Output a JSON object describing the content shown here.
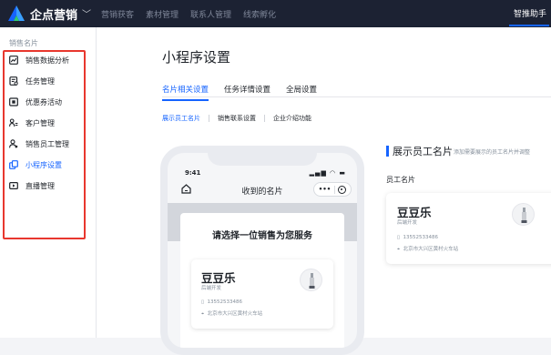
{
  "topbar": {
    "brand": "企点营销",
    "nav": [
      "营销获客",
      "素材管理",
      "联系人管理",
      "线索孵化"
    ],
    "helper": "智推助手"
  },
  "sidebar": {
    "title": "销售名片",
    "items": [
      {
        "label": "销售数据分析",
        "icon": "chart-icon"
      },
      {
        "label": "任务管理",
        "icon": "task-icon"
      },
      {
        "label": "优惠券活动",
        "icon": "coupon-icon"
      },
      {
        "label": "客户管理",
        "icon": "customer-icon"
      },
      {
        "label": "销售员工管理",
        "icon": "staff-icon"
      },
      {
        "label": "小程序设置",
        "icon": "miniprogram-icon",
        "active": true
      },
      {
        "label": "直播管理",
        "icon": "live-icon"
      }
    ]
  },
  "main": {
    "title": "小程序设置",
    "tabs": [
      {
        "label": "名片相关设置",
        "active": true
      },
      {
        "label": "任务详情设置"
      },
      {
        "label": "全局设置"
      }
    ],
    "subtabs": [
      {
        "label": "展示员工名片",
        "active": true
      },
      {
        "label": "销售联系设置"
      },
      {
        "label": "企业介绍功能"
      }
    ]
  },
  "phone": {
    "time": "9:41",
    "status": "▂▄▆ ◠ ▬",
    "nav_title": "收到的名片",
    "capsule_dots": "•••",
    "heading": "请选择一位销售为您服务",
    "card": {
      "name": "豆豆乐",
      "role": "后端开发",
      "phone": "13552533486",
      "address": "北京市大兴区黄村火车站"
    }
  },
  "right_panel": {
    "title": "展示员工名片",
    "hint": "添加需要展示的员工名片并调整",
    "label": "员工名片",
    "card": {
      "name": "豆豆乐",
      "role": "后端开发",
      "phone": "13552533486",
      "address": "北京市大兴区黄村火车站"
    }
  },
  "colors": {
    "accent": "#1664ff",
    "topbar": "#1c2233",
    "highlight_box": "#e8372e"
  }
}
